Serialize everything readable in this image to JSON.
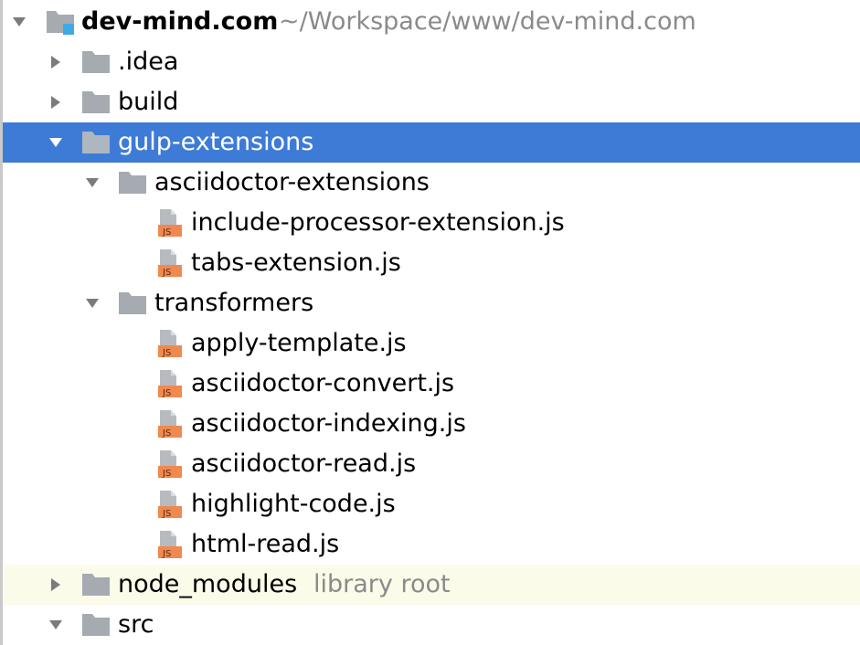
{
  "colors": {
    "selection": "#3e7bd6",
    "library_row": "#fbfbe9",
    "folder": "#a5abb0",
    "js_badge": "#f08950",
    "hint_text": "#8a8a8a",
    "module_marker": "#3fa9e8"
  },
  "tree": {
    "project": {
      "name": "dev-mind.com",
      "path": "~/Workspace/www/dev-mind.com",
      "icon": "module-folder-icon",
      "expanded": true
    },
    "idea": {
      "name": ".idea",
      "icon": "folder-icon",
      "expanded": false
    },
    "build": {
      "name": "build",
      "icon": "folder-icon",
      "expanded": false
    },
    "gulp_extensions": {
      "name": "gulp-extensions",
      "icon": "folder-icon",
      "expanded": true,
      "selected": true
    },
    "asciidoctor_extensions": {
      "name": "asciidoctor-extensions",
      "icon": "folder-icon",
      "expanded": true,
      "files": [
        {
          "name": "include-processor-extension.js",
          "icon": "js-file-icon"
        },
        {
          "name": "tabs-extension.js",
          "icon": "js-file-icon"
        }
      ]
    },
    "transformers": {
      "name": "transformers",
      "icon": "folder-icon",
      "expanded": true,
      "files": [
        {
          "name": "apply-template.js",
          "icon": "js-file-icon"
        },
        {
          "name": "asciidoctor-convert.js",
          "icon": "js-file-icon"
        },
        {
          "name": "asciidoctor-indexing.js",
          "icon": "js-file-icon"
        },
        {
          "name": "asciidoctor-read.js",
          "icon": "js-file-icon"
        },
        {
          "name": "highlight-code.js",
          "icon": "js-file-icon"
        },
        {
          "name": "html-read.js",
          "icon": "js-file-icon"
        }
      ]
    },
    "node_modules": {
      "name": "node_modules",
      "hint": "library root",
      "icon": "folder-icon",
      "expanded": false
    },
    "src": {
      "name": "src",
      "icon": "folder-icon",
      "expanded": true
    }
  }
}
